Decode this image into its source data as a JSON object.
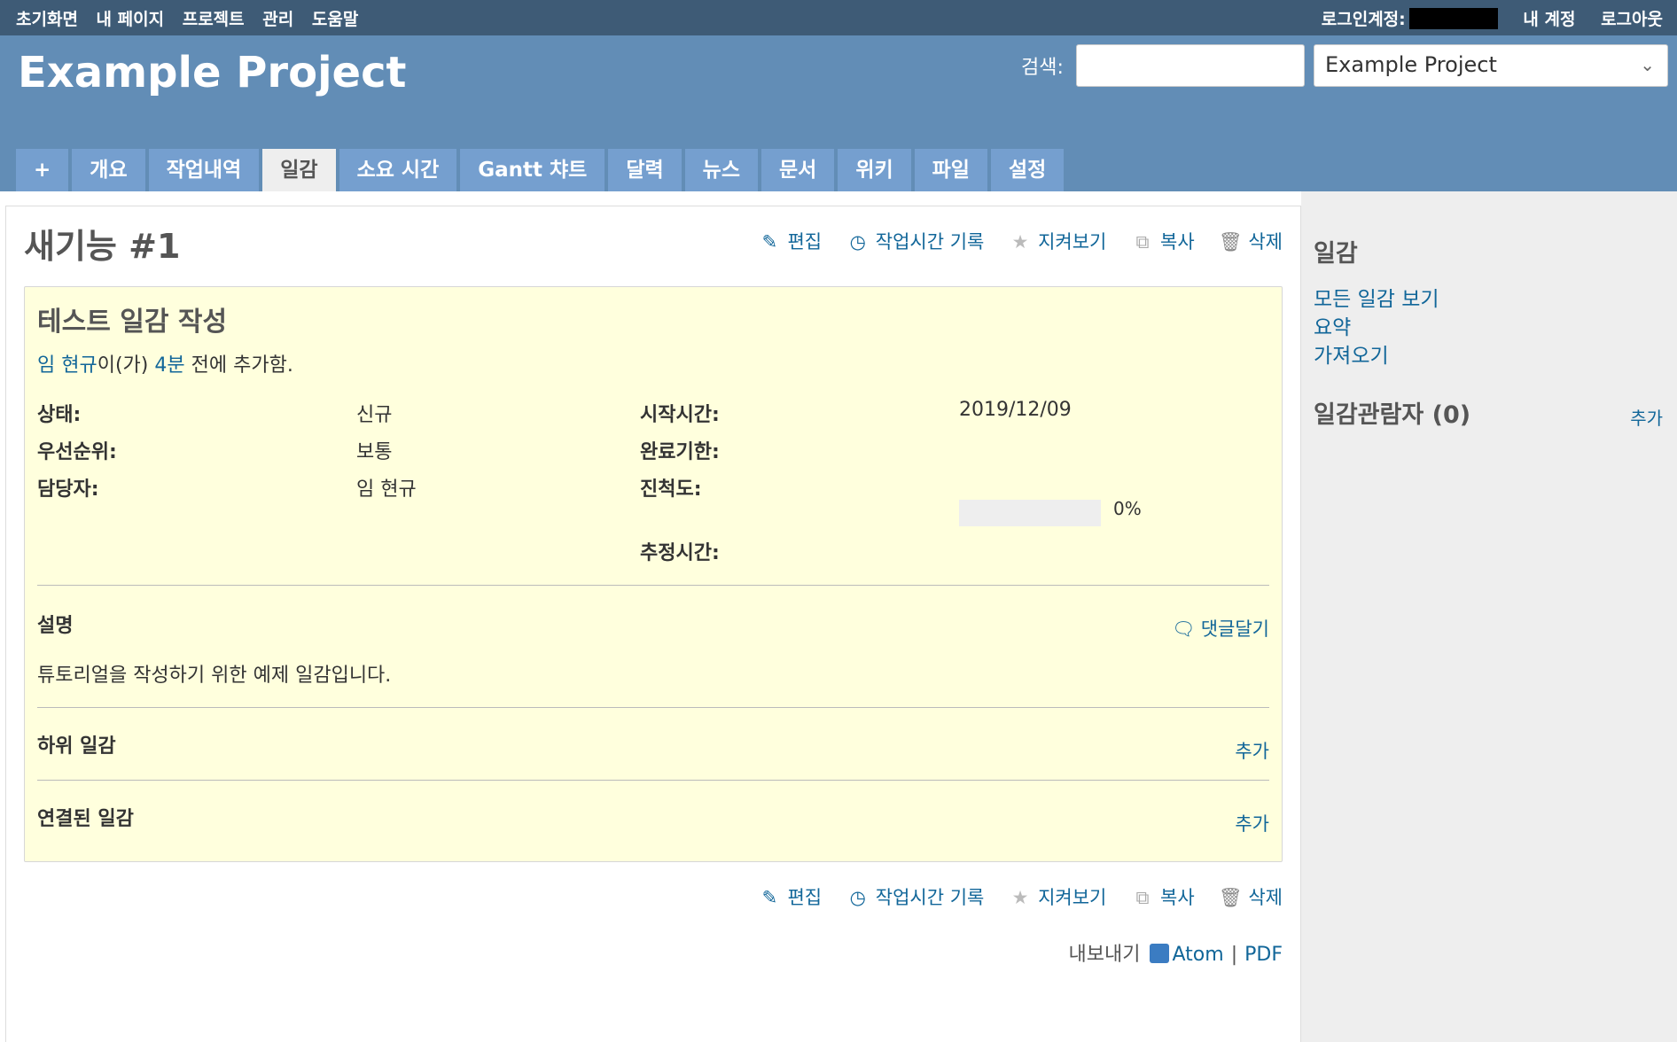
{
  "top_menu": {
    "home": "초기화면",
    "my_page": "내 페이지",
    "projects": "프로젝트",
    "admin": "관리",
    "help": "도움말",
    "logged_as": "로그인계정:",
    "my_account": "내 계정",
    "logout": "로그아웃"
  },
  "header": {
    "project_title": "Example Project",
    "search_label": "검색:",
    "search_value": "",
    "project_select": "Example Project"
  },
  "tabs": [
    "+",
    "개요",
    "작업내역",
    "일감",
    "소요 시간",
    "Gantt 챠트",
    "달력",
    "뉴스",
    "문서",
    "위키",
    "파일",
    "설정"
  ],
  "selected_tab": "일감",
  "actions": {
    "edit": "편집",
    "log_time": "작업시간 기록",
    "watch": "지켜보기",
    "copy": "복사",
    "delete": "삭제"
  },
  "issue": {
    "heading": "새기능 #1",
    "subject": "테스트 일감 작성",
    "author": "임 현규",
    "author_suffix": "이(가)",
    "time_ago": "4분",
    "added_suffix": "전에 추가함.",
    "attributes": {
      "status_label": "상태:",
      "status": "신규",
      "priority_label": "우선순위:",
      "priority": "보통",
      "assignee_label": "담당자:",
      "assignee": "임 현규",
      "start_label": "시작시간:",
      "start": "2019/12/09",
      "due_label": "완료기한:",
      "due": "",
      "progress_label": "진척도:",
      "progress": "0%",
      "progress_value": 0,
      "estimated_label": "추정시간:",
      "estimated": ""
    },
    "description_title": "설명",
    "quote_link": "댓글달기",
    "description": "튜토리얼을 작성하기 위한 예제 일감입니다.",
    "subtasks_title": "하위 일감",
    "subtasks_add": "추가",
    "relations_title": "연결된 일감",
    "relations_add": "추가"
  },
  "export": {
    "label": "내보내기",
    "atom": "Atom",
    "separator": "|",
    "pdf": "PDF"
  },
  "sidebar": {
    "title": "일감",
    "links": [
      "모든 일감 보기",
      "요약",
      "가져오기"
    ],
    "watchers_title": "일감관람자 (0)",
    "watchers_add": "추가"
  }
}
